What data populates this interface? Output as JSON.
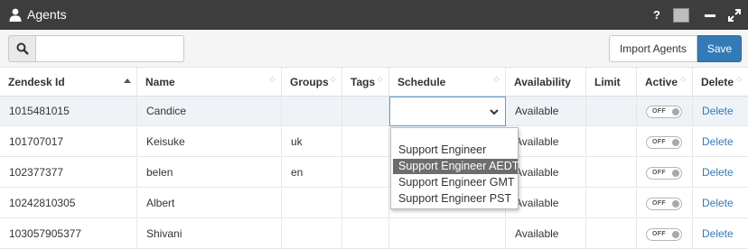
{
  "window": {
    "title": "Agents",
    "help_label": "?"
  },
  "toolbar": {
    "search_placeholder": "",
    "import_label": "Import Agents",
    "save_label": "Save"
  },
  "columns": [
    "Zendesk Id",
    "Name",
    "Groups",
    "Tags",
    "Schedule",
    "Availability",
    "Limit",
    "Active",
    "Delete"
  ],
  "rows": [
    {
      "id": "1015481015",
      "name": "Candice",
      "groups": "",
      "tags": "",
      "schedule": "",
      "availability": "Available",
      "limit": "",
      "active": "OFF",
      "delete": "Delete"
    },
    {
      "id": "101707017",
      "name": "Keisuke",
      "groups": "uk",
      "tags": "",
      "schedule": "",
      "availability": "Available",
      "limit": "",
      "active": "OFF",
      "delete": "Delete"
    },
    {
      "id": "102377377",
      "name": "belen",
      "groups": "en",
      "tags": "",
      "schedule": "",
      "availability": "Available",
      "limit": "",
      "active": "OFF",
      "delete": "Delete"
    },
    {
      "id": "10242810305",
      "name": "Albert",
      "groups": "",
      "tags": "",
      "schedule": "",
      "availability": "Available",
      "limit": "",
      "active": "OFF",
      "delete": "Delete"
    },
    {
      "id": "103057905377",
      "name": "Shivani",
      "groups": "",
      "tags": "",
      "schedule": "",
      "availability": "Available",
      "limit": "",
      "active": "OFF",
      "delete": "Delete"
    }
  ],
  "schedule_dropdown": {
    "selected": "",
    "options": [
      "",
      "Support Engineer",
      "Support Engineer AEDT",
      "Support Engineer GMT",
      "Support Engineer PST"
    ],
    "highlighted": "Support Engineer AEDT"
  },
  "colors": {
    "titlebar": "#3d3d3d",
    "accent": "#337ab7",
    "selected_row": "#eef3f8",
    "highlight": "#6d6d6d"
  }
}
